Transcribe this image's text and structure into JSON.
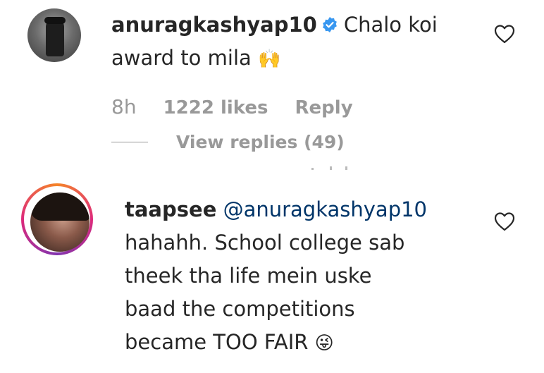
{
  "comments": [
    {
      "username": "anuragkashyap10",
      "verified": true,
      "text": "Chalo koi award to mila",
      "emoji": "🙌",
      "time": "8h",
      "likes": "1222 likes",
      "reply_label": "Reply",
      "view_replies": "View replies (49)"
    },
    {
      "username": "taapsee",
      "mention": "@anuragkashyap10",
      "line1": "hahahh. School college sab",
      "line2": "theek tha life mein uske",
      "line3": "baad the competitions",
      "line4": "became TOO FAIR",
      "emoji": "😜"
    }
  ],
  "icons": {
    "like": "heart-outline-icon",
    "verified": "verified-badge-icon"
  },
  "colors": {
    "verified": "#3897f0",
    "mention": "#003569",
    "meta": "#999999",
    "text": "#262626"
  }
}
